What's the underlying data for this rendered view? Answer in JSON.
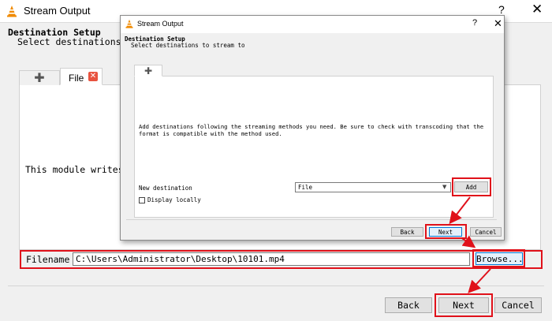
{
  "colors": {
    "highlight": "#e0111a",
    "accent": "#0078d7",
    "vlc_orange": "#f08a00"
  },
  "outer": {
    "title": "Stream Output",
    "help_glyph": "?",
    "close_glyph": "✕",
    "heading": "Destination Setup",
    "subheading": "Select destinations to stre",
    "tab_plus": "✚",
    "tab_file": "File",
    "tab_close_glyph": "✕",
    "module_text": "This module writes the t",
    "filename_label": "Filename",
    "filename_value": "C:\\Users\\Administrator\\Desktop\\10101.mp4",
    "browse": "Browse...",
    "back": "Back",
    "next": "Next",
    "cancel": "Cancel"
  },
  "inner": {
    "title": "Stream Output",
    "help_glyph": "?",
    "close_glyph": "✕",
    "heading": "Destination Setup",
    "subheading": "Select destinations to stream to",
    "tab_plus": "✚",
    "description": "Add destinations following the streaming methods you need. Be sure to check with transcoding that the format is compatible with the method used.",
    "new_destination_label": "New destination",
    "destination_select": "File",
    "add": "Add",
    "display_locally": "Display locally",
    "back": "Back",
    "next": "Next",
    "cancel": "Cancel"
  }
}
